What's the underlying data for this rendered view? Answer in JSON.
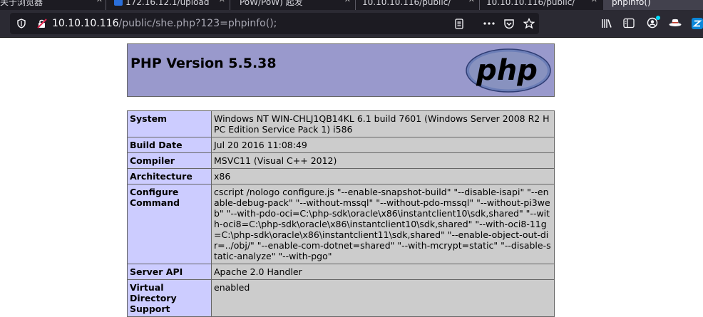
{
  "browser": {
    "tabs": [
      {
        "label": "关于浏览器",
        "close_icon": "x-icon"
      },
      {
        "label": "172.16.12.1/upload",
        "close_icon": "x-icon"
      },
      {
        "label": "PoW/PoW) 起发",
        "close_icon": "x-icon"
      },
      {
        "label": "10.10.10.116/public/",
        "close_icon": "x-icon"
      },
      {
        "label": "10.10.10.116/public/",
        "close_icon": "x-icon"
      },
      {
        "label": "phpinfo()",
        "close_icon": "x-icon"
      }
    ],
    "url": {
      "host": "10.10.10.116",
      "path": "/public/she.php?123=phpinfo();"
    },
    "icons": [
      "shield-icon",
      "insecure-lock-icon",
      "reader-view-icon",
      "more-icon",
      "pocket-icon",
      "bookmark-star-icon",
      "library-icon",
      "sidebar-icon",
      "account-icon",
      "extension-hat-icon",
      "extension-z-icon"
    ],
    "accent_color": "#00ddff"
  },
  "phpinfo": {
    "title": "PHP Version 5.5.38",
    "logo_text": "php",
    "rows": [
      {
        "key": "System",
        "value": "Windows NT WIN-CHLJ1QB14KL 6.1 build 7601 (Windows Server 2008 R2 HPC Edition Service Pack 1) i586"
      },
      {
        "key": "Build Date",
        "value": "Jul 20 2016 11:08:49"
      },
      {
        "key": "Compiler",
        "value": "MSVC11 (Visual C++ 2012)"
      },
      {
        "key": "Architecture",
        "value": "x86"
      },
      {
        "key": "Configure Command",
        "value": "cscript /nologo configure.js \"--enable-snapshot-build\" \"--disable-isapi\" \"--enable-debug-pack\" \"--without-mssql\" \"--without-pdo-mssql\" \"--without-pi3web\" \"--with-pdo-oci=C:\\php-sdk\\oracle\\x86\\instantclient10\\sdk,shared\" \"--with-oci8=C:\\php-sdk\\oracle\\x86\\instantclient10\\sdk,shared\" \"--with-oci8-11g=C:\\php-sdk\\oracle\\x86\\instantclient11\\sdk,shared\" \"--enable-object-out-dir=../obj/\" \"--enable-com-dotnet=shared\" \"--with-mcrypt=static\" \"--disable-static-analyze\" \"--with-pgo\""
      },
      {
        "key": "Server API",
        "value": "Apache 2.0 Handler"
      },
      {
        "key": "Virtual Directory Support",
        "value": "enabled"
      }
    ],
    "colors": {
      "header_bg": "#9999cc",
      "key_bg": "#ccccff",
      "value_bg": "#cccccc",
      "border": "#666666"
    }
  }
}
